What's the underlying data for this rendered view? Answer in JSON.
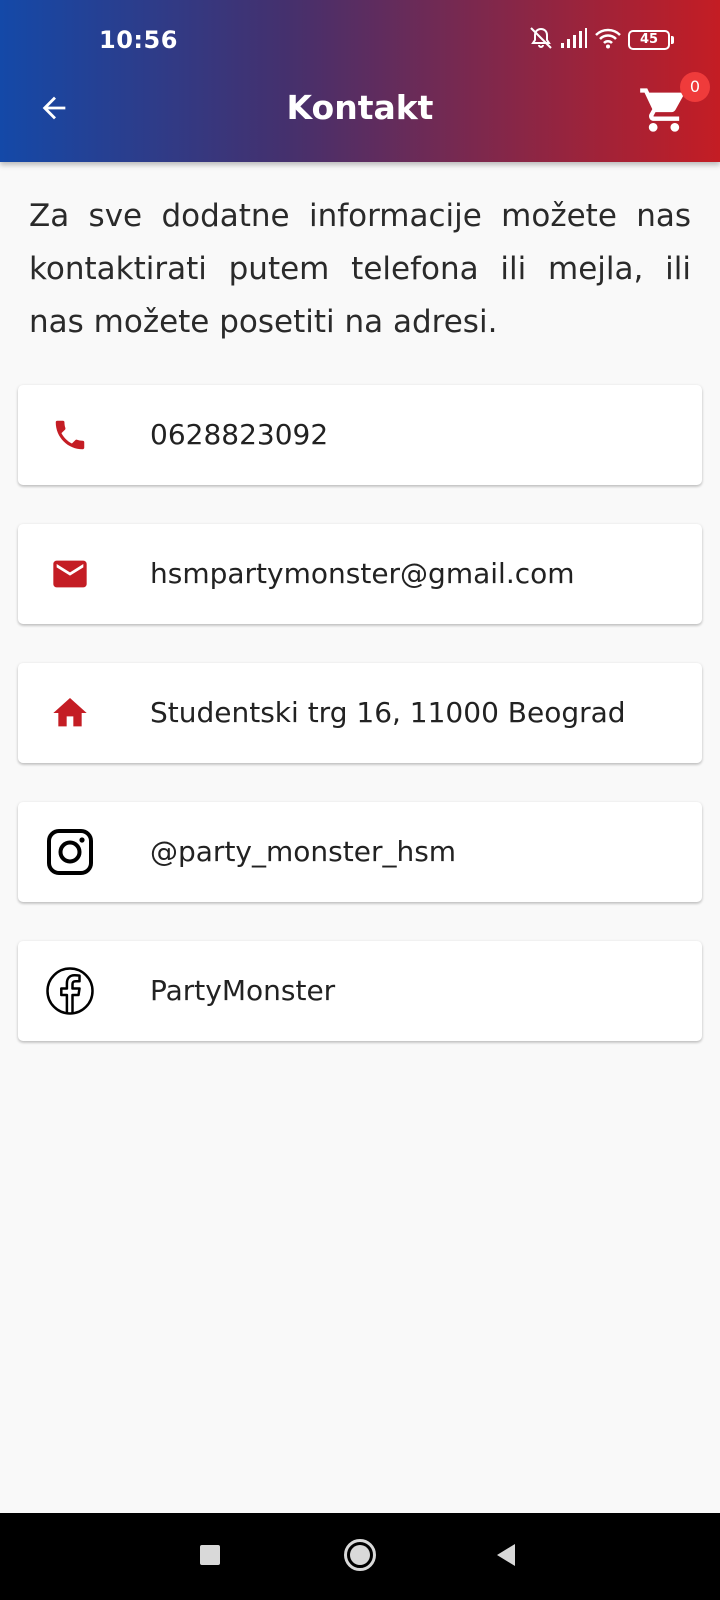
{
  "status": {
    "time": "10:56",
    "battery": "45",
    "icons": [
      "mute-bell-icon",
      "signal-icon",
      "wifi-icon",
      "battery-icon"
    ]
  },
  "appbar": {
    "title": "Kontakt",
    "back_icon": "arrow-left-icon",
    "cart_icon": "shopping-cart-icon",
    "cart_count": "0"
  },
  "intro_text": "Za sve dodatne informacije možete nas kontaktirati putem telefona ili mejla, ili nas možete posetiti na adresi.",
  "contacts": [
    {
      "icon": "phone-icon",
      "value": "0628823092"
    },
    {
      "icon": "mail-icon",
      "value": "hsmpartymonster@gmail.com"
    },
    {
      "icon": "home-icon",
      "value": "Studentski trg 16, 11000 Beograd"
    },
    {
      "icon": "instagram-icon",
      "value": "@party_monster_hsm"
    },
    {
      "icon": "facebook-icon",
      "value": "PartyMonster"
    }
  ],
  "nav": {
    "icons": [
      "recents-square-icon",
      "home-circle-icon",
      "back-triangle-icon"
    ]
  },
  "colors": {
    "accent_red": "#c41d24",
    "gradient_start": "#1449a8",
    "gradient_end": "#c41d24",
    "badge": "#ef3b3b"
  }
}
